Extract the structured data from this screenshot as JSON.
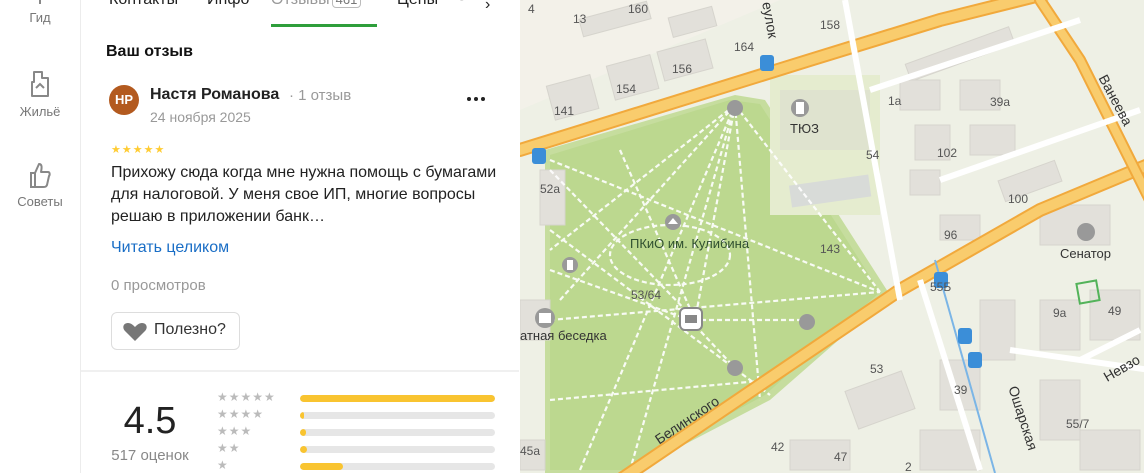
{
  "rail": {
    "items": [
      {
        "label": "Гид",
        "icon": "guide-icon"
      },
      {
        "label": "Жильё",
        "icon": "housing-icon"
      },
      {
        "label": "Советы",
        "icon": "thumbs-up-icon"
      }
    ]
  },
  "tabs": {
    "items": [
      "Контакты",
      "Инфо",
      "Отзывы",
      "Цены"
    ],
    "active": "Отзывы",
    "reviews_count": "461"
  },
  "review": {
    "section_title": "Ваш отзыв",
    "avatar_initials": "НР",
    "author": "Настя Романова",
    "author_meta": "· 1 отзыв",
    "date": "24 ноября 2025",
    "stars": "★★★★★",
    "text": "Прихожу сюда когда мне нужна помощь с бумагами для налоговой. У меня свое ИП, многие вопросы решаю в приложении банк…",
    "read_more": "Читать целиком",
    "views": "0 просмотров",
    "useful_label": "Полезно?"
  },
  "rating": {
    "value": "4.5",
    "count": "517 оценок",
    "distribution": [
      {
        "stars": "★★★★★",
        "fraction": 1.0
      },
      {
        "stars": "★★★★",
        "fraction": 0.02
      },
      {
        "stars": "★★★",
        "fraction": 0.03
      },
      {
        "stars": "★★",
        "fraction": 0.035
      },
      {
        "stars": "★",
        "fraction": 0.22
      }
    ]
  },
  "map": {
    "park_label": "ПКиО им. Кулибина",
    "theatre_label": "ТЮЗ",
    "gazebo_label": "атная беседка",
    "senator_label": "Сенатор",
    "streets": {
      "belinsky": "Белинского",
      "vaneeva": "Ванеева",
      "osharskaya": "Ошарская",
      "nevzo": "Невзо",
      "pereulok": "еулок"
    },
    "house_numbers": [
      "4",
      "13",
      "160",
      "164",
      "158",
      "156",
      "154",
      "141",
      "52а",
      "1а",
      "39а",
      "54",
      "102",
      "100",
      "96",
      "143",
      "53/64",
      "55Б",
      "9а",
      "49",
      "53",
      "39",
      "55/7",
      "45а",
      "42",
      "47",
      "2"
    ]
  },
  "colors": {
    "accent_green": "#2e9e3b",
    "star_yellow": "#f9c430",
    "link_blue": "#1a6ec6",
    "road_orange": "#f5b342",
    "park_green": "#bcd88f",
    "avatar_brown": "#b35a1f"
  }
}
